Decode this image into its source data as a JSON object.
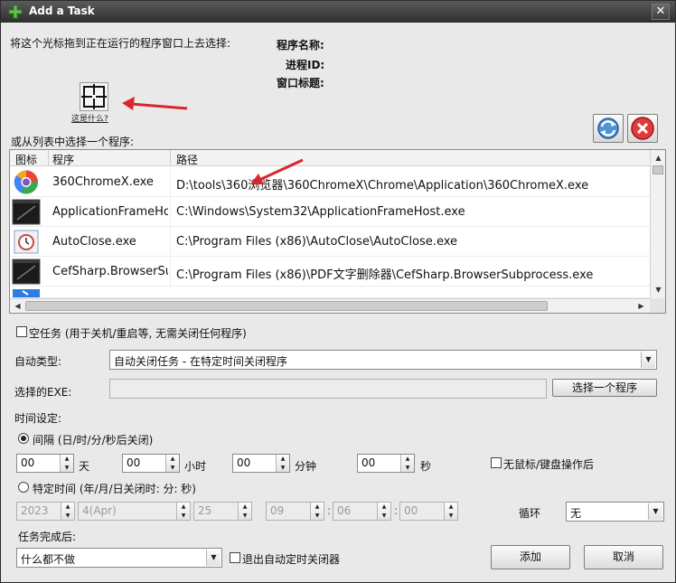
{
  "window": {
    "title": "Add a Task",
    "close_glyph": "✕"
  },
  "drag": {
    "instruction": "将这个光标拖到正在运行的程序窗口上去选择:",
    "link": "这是什么?"
  },
  "info": {
    "program_name_label": "程序名称:",
    "pid_label": "进程ID:",
    "window_title_label": "窗口标题:"
  },
  "list": {
    "caption": "或从列表中选择一个程序:",
    "columns": {
      "icon": "图标",
      "program": "程序",
      "path": "路径"
    },
    "rows": [
      {
        "icon": "360chrome-icon",
        "program": "360ChromeX.exe",
        "path": "D:\\tools\\360浏览器\\360ChromeX\\Chrome\\Application\\360ChromeX.exe"
      },
      {
        "icon": "application-frame-icon",
        "program": "ApplicationFrameHost.exe",
        "path": "C:\\Windows\\System32\\ApplicationFrameHost.exe"
      },
      {
        "icon": "autoclose-icon",
        "program": "AutoClose.exe",
        "path": "C:\\Program Files (x86)\\AutoClose\\AutoClose.exe"
      },
      {
        "icon": "cefsharp-icon",
        "program": "CefSharp.BrowserSubprocess.exe",
        "path": "C:\\Program Files (x86)\\PDF文字删除器\\CefSharp.BrowserSubprocess.exe"
      }
    ]
  },
  "empty_task": {
    "label": "空任务 (用于关机/重启等, 无需关闭任何程序)",
    "checked": false
  },
  "auto_type": {
    "label": "自动类型:",
    "value": "自动关闭任务 - 在特定时间关闭程序"
  },
  "exe": {
    "label": "选择的EXE:",
    "value": "",
    "button": "选择一个程序"
  },
  "time": {
    "label": "时间设定:",
    "interval": {
      "label": "间隔 (日/时/分/秒后关闭)",
      "selected": true,
      "days": "00",
      "days_unit": "天",
      "hours": "00",
      "hours_unit": "小时",
      "minutes": "00",
      "minutes_unit": "分钟",
      "seconds": "00",
      "seconds_unit": "秒"
    },
    "no_input": {
      "label": "无鼠标/键盘操作后",
      "checked": false
    },
    "specific": {
      "label": "特定时间 (年/月/日关闭时: 分: 秒)",
      "selected": false,
      "year": "2023",
      "month": "4(Apr)",
      "day": "25",
      "hour": "09",
      "minute": "06",
      "second": "00"
    },
    "loop": {
      "label": "循环",
      "value": "无"
    }
  },
  "after": {
    "label": "任务完成后:",
    "value": "什么都不做",
    "exit_label": "退出自动定时关闭器",
    "exit_checked": false
  },
  "buttons": {
    "add": "添加",
    "cancel": "取消"
  },
  "colors": {
    "titlebar": "#3c3c3c",
    "dialog_bg": "#e9e9e9",
    "arrow": "#d9262c"
  }
}
